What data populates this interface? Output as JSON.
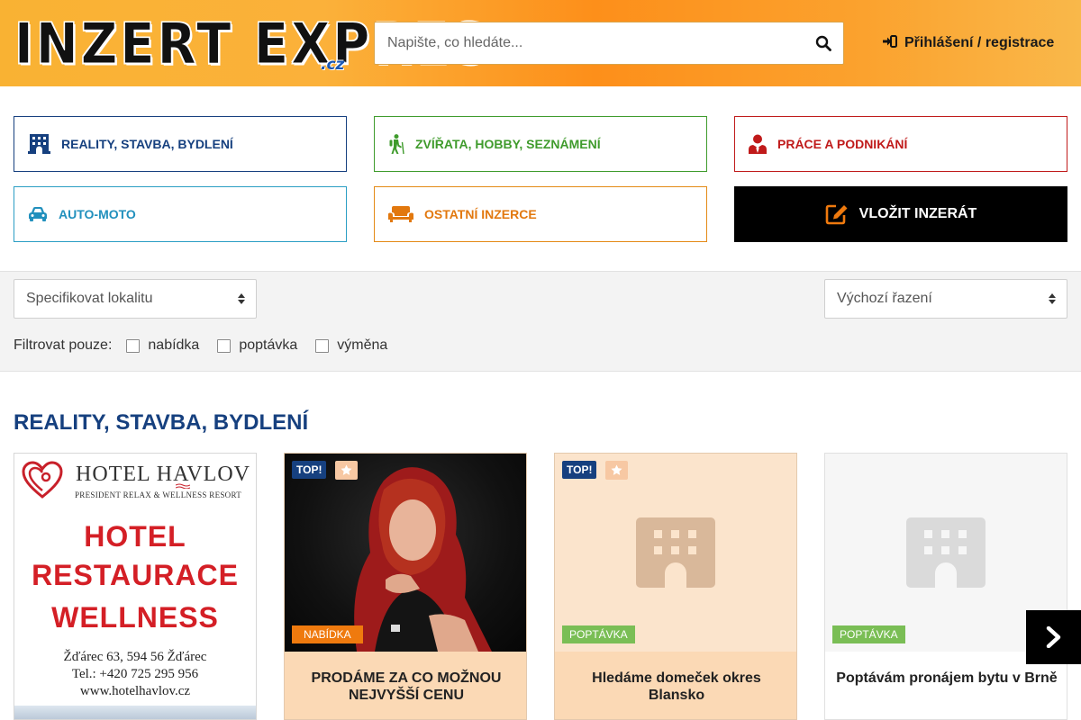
{
  "header": {
    "logo_text": "INZERT EXPRES",
    "logo_tld": ".cz",
    "search_placeholder": "Napište, co hledáte...",
    "login_label": "Přihlášení / registrace"
  },
  "categories": {
    "reality": "REALITY, STAVBA, BYDLENÍ",
    "zvirata": "ZVÍŘATA, HOBBY, SEZNÁMENÍ",
    "prace": "PRÁCE A PODNIKÁNÍ",
    "auto": "AUTO-MOTO",
    "ostatni": "OSTATNÍ INZERCE",
    "vlozit": "VLOŽIT INZERÁT"
  },
  "filters": {
    "locality": "Specifikovat lokalitu",
    "sort": "Výchozí řazení",
    "filter_label": "Filtrovat pouze:",
    "options": [
      "nabídka",
      "poptávka",
      "výměna"
    ]
  },
  "section": {
    "title": "REALITY, STAVBA, BYDLENÍ"
  },
  "ad": {
    "name": "HOTEL HAVLOV",
    "subtitle": "PRESIDENT RELAX & WELLNESS RESORT",
    "lines": [
      "HOTEL",
      "RESTAURACE",
      "WELLNESS"
    ],
    "address": "Žďárec 63, 594 56 Žďárec",
    "phone": "Tel.: +420 725 295 956",
    "web": "www.hotelhavlov.cz"
  },
  "cards": [
    {
      "top": "TOP!",
      "type": "NABÍDKA",
      "title": "PRODÁME ZA CO MOŽNOU NEJVYŠŠÍ CENU"
    },
    {
      "top": "TOP!",
      "type": "POPTÁVKA",
      "title": "Hledáme domeček okres Blansko"
    },
    {
      "type": "POPTÁVKA",
      "title": "Poptávám pronájem bytu v Brně"
    }
  ],
  "colors": {
    "brand_blue": "#16407f",
    "green": "#3f9b2c",
    "red": "#c01a1a",
    "cyan": "#2190bd",
    "orange": "#e2780e"
  }
}
